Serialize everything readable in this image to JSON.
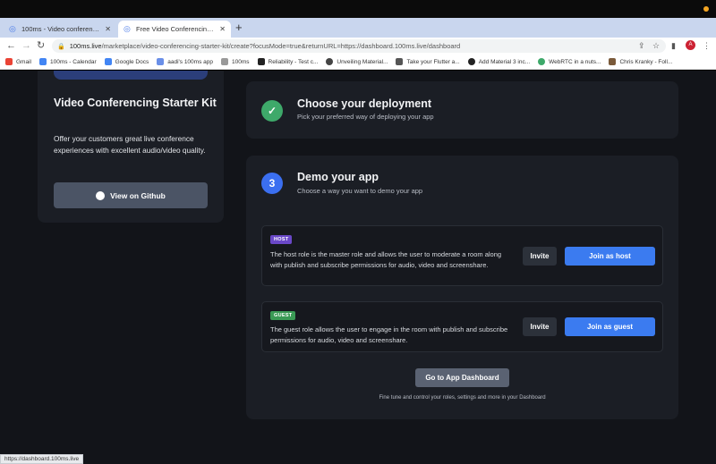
{
  "browser": {
    "tabs": [
      {
        "title": "100ms - Video conferencing a",
        "active": false
      },
      {
        "title": "Free Video Conferencing Starte",
        "active": true
      }
    ],
    "new_tab": "+",
    "url_host": "100ms.live",
    "url_path": "/marketplace/video-conferencing-starter-kit/create?focusMode=true&returnURL=https://dashboard.100ms.live/dashboard",
    "avatar_letter": "A",
    "bookmarks": [
      {
        "label": "Gmail",
        "color": "#ea4335"
      },
      {
        "label": "100ms - Calendar",
        "color": "#4285f4"
      },
      {
        "label": "Google Docs",
        "color": "#4285f4"
      },
      {
        "label": "aadi's 100ms app",
        "color": "#6a8fe8"
      },
      {
        "label": "100ms",
        "color": "#777777"
      },
      {
        "label": "Reliability - Test c...",
        "color": "#222222"
      },
      {
        "label": "Unveiling Material...",
        "color": "#444444"
      },
      {
        "label": "Take your Flutter a...",
        "color": "#555555"
      },
      {
        "label": "Add Material 3 inc...",
        "color": "#222222"
      },
      {
        "label": "WebRTC in a nuts...",
        "color": "#3ea96a"
      },
      {
        "label": "Chris Kranky - Foll...",
        "color": "#7a5a3a"
      }
    ],
    "status_url": "https://dashboard.100ms.live"
  },
  "kit": {
    "title": "Video Conferencing Starter Kit",
    "description": "Offer your customers great live conference experiences with excellent audio/video quality.",
    "github_label": "View on Github"
  },
  "step2": {
    "title": "Choose your deployment",
    "subtitle": "Pick your preferred way of deploying your app",
    "check": "✓"
  },
  "step3": {
    "number": "3",
    "title": "Demo your app",
    "subtitle": "Choose a way you want to demo your app",
    "host": {
      "badge": "HOST",
      "description": "The host role is the master role and allows the user to moderate a room along with publish and subscribe permissions for audio, video and screenshare.",
      "invite_label": "Invite",
      "join_label": "Join as host"
    },
    "guest": {
      "badge": "GUEST",
      "description": "The guest role allows the user to engage in the room with publish and subscribe permissions for audio, video and screenshare.",
      "invite_label": "Invite",
      "join_label": "Join as guest"
    },
    "dashboard_label": "Go to App Dashboard",
    "dashboard_note": "Fine tune and control your roles, settings and more in your Dashboard"
  },
  "colors": {
    "accent": "#3b7bf0",
    "success": "#3ea96a",
    "host_badge": "#6a48c8",
    "guest_badge": "#3a9a55",
    "background": "#121419",
    "card": "#1b1e25"
  }
}
